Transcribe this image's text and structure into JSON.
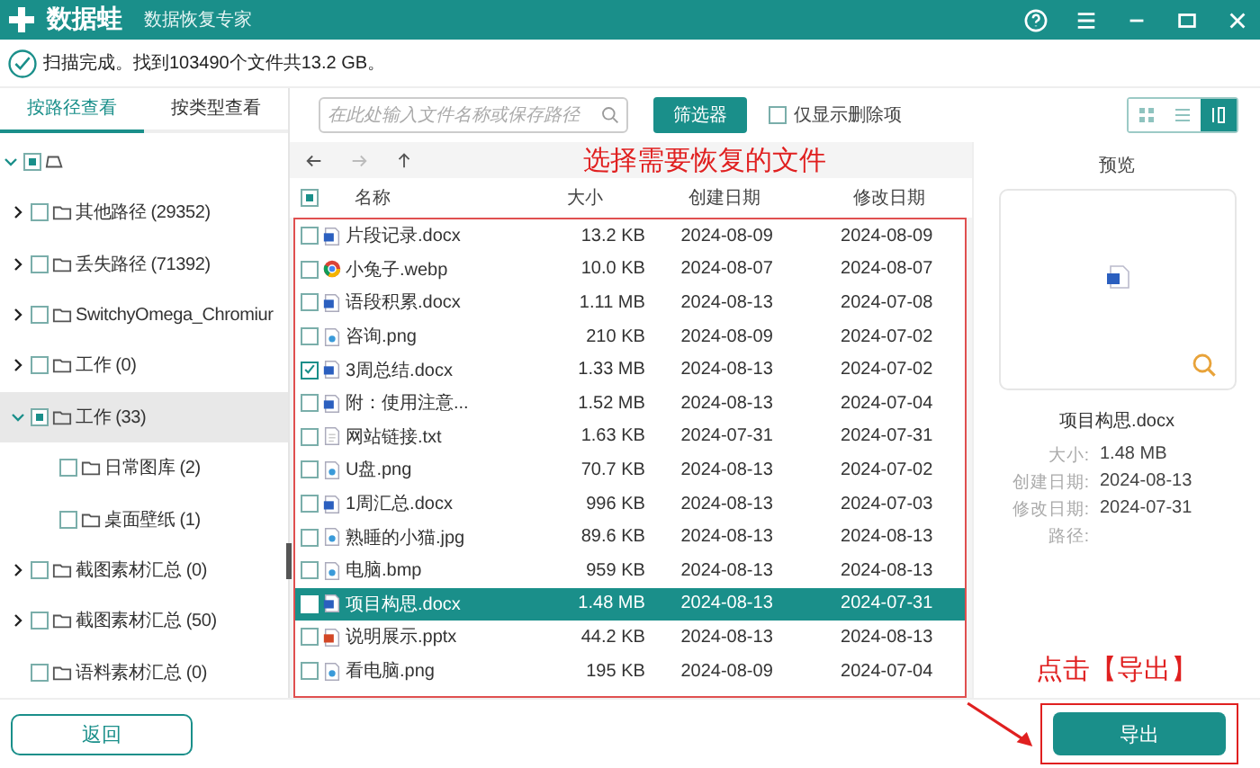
{
  "app": {
    "name": "数据蛙",
    "subtitle": "数据恢复专家"
  },
  "status": "扫描完成。找到103490个文件共13.2 GB。",
  "view_tabs": [
    {
      "label": "按路径查看",
      "selected": true
    },
    {
      "label": "按类型查看",
      "selected": false
    }
  ],
  "tree": [
    {
      "expanded": true,
      "partial": true,
      "selected": false,
      "children": [
        {
          "label": "其他路径 (29352)",
          "expanded": false,
          "has_children": true,
          "partial": false,
          "selected": false
        },
        {
          "label": "丢失路径 (71392)",
          "expanded": false,
          "has_children": true,
          "partial": false,
          "selected": false
        },
        {
          "label": "SwitchyOmega_Chromiur",
          "expanded": false,
          "has_children": true,
          "partial": false,
          "selected": false
        },
        {
          "label": "工作 (0)",
          "expanded": false,
          "has_children": true,
          "partial": false,
          "selected": false
        },
        {
          "label": "工作 (33)",
          "expanded": true,
          "has_children": true,
          "partial": true,
          "selected": true,
          "children": [
            {
              "label": "日常图库 (2)",
              "has_children": false,
              "partial": false,
              "selected": false
            },
            {
              "label": "桌面壁纸 (1)",
              "has_children": false,
              "partial": false,
              "selected": false
            }
          ]
        },
        {
          "label": "截图素材汇总 (0)",
          "expanded": false,
          "has_children": true,
          "partial": false,
          "selected": false
        },
        {
          "label": "截图素材汇总 (50)",
          "expanded": false,
          "has_children": true,
          "partial": false,
          "selected": false
        },
        {
          "label": "语料素材汇总 (0)",
          "has_children": false,
          "partial": false,
          "selected": false
        }
      ]
    }
  ],
  "back_button": "返回",
  "search": {
    "placeholder": "在此处输入文件名称或保存路径"
  },
  "filter_button": "筛选器",
  "deleted_only": {
    "label": "仅显示删除项",
    "checked": false
  },
  "view_modes": [
    {
      "kind": "grid",
      "selected": false
    },
    {
      "kind": "list",
      "selected": false
    },
    {
      "kind": "detail",
      "selected": true
    }
  ],
  "annotations": [
    "选择需要恢复的文件",
    "点击【导出】"
  ],
  "table": {
    "header_partial": true,
    "columns": [
      "名称",
      "大小",
      "创建日期",
      "修改日期"
    ],
    "rows": [
      {
        "kind": "doc",
        "name": "片段记录.docx",
        "size": "13.2 KB",
        "created": "2024-08-09",
        "modified": "2024-08-09",
        "checked": false,
        "selected": false
      },
      {
        "kind": "web",
        "name": "小兔子.webp",
        "size": "10.0 KB",
        "created": "2024-08-07",
        "modified": "2024-08-07",
        "checked": false,
        "selected": false
      },
      {
        "kind": "doc",
        "name": "语段积累.docx",
        "size": "1.11 MB",
        "created": "2024-08-13",
        "modified": "2024-07-08",
        "checked": false,
        "selected": false
      },
      {
        "kind": "image",
        "name": "咨询.png",
        "size": "210 KB",
        "created": "2024-08-09",
        "modified": "2024-07-02",
        "checked": false,
        "selected": false
      },
      {
        "kind": "doc",
        "name": "3周总结.docx",
        "size": "1.33 MB",
        "created": "2024-08-13",
        "modified": "2024-07-02",
        "checked": true,
        "selected": false
      },
      {
        "kind": "doc",
        "name": "附：使用注意...",
        "size": "1.52 MB",
        "created": "2024-08-13",
        "modified": "2024-07-04",
        "checked": false,
        "selected": false
      },
      {
        "kind": "text",
        "name": "网站链接.txt",
        "size": "1.63 KB",
        "created": "2024-07-31",
        "modified": "2024-07-31",
        "checked": false,
        "selected": false
      },
      {
        "kind": "image",
        "name": "U盘.png",
        "size": "70.7 KB",
        "created": "2024-08-13",
        "modified": "2024-07-02",
        "checked": false,
        "selected": false
      },
      {
        "kind": "doc",
        "name": "1周汇总.docx",
        "size": "996 KB",
        "created": "2024-08-13",
        "modified": "2024-07-03",
        "checked": false,
        "selected": false
      },
      {
        "kind": "image",
        "name": "熟睡的小猫.jpg",
        "size": "89.6 KB",
        "created": "2024-08-13",
        "modified": "2024-08-13",
        "checked": false,
        "selected": false
      },
      {
        "kind": "image",
        "name": "电脑.bmp",
        "size": "959 KB",
        "created": "2024-08-13",
        "modified": "2024-08-13",
        "checked": false,
        "selected": false
      },
      {
        "kind": "doc",
        "name": "项目构思.docx",
        "size": "1.48 MB",
        "created": "2024-08-13",
        "modified": "2024-07-31",
        "checked": false,
        "selected": true
      },
      {
        "kind": "slides",
        "name": "说明展示.pptx",
        "size": "44.2 KB",
        "created": "2024-08-13",
        "modified": "2024-08-13",
        "checked": false,
        "selected": false
      },
      {
        "kind": "image",
        "name": "看电脑.png",
        "size": "195 KB",
        "created": "2024-08-09",
        "modified": "2024-07-04",
        "checked": false,
        "selected": false
      }
    ]
  },
  "preview": {
    "title": "预览",
    "file_name": "项目构思.docx",
    "details": [
      {
        "label": "大小:",
        "value": "1.48 MB"
      },
      {
        "label": "创建日期:",
        "value": "2024-08-13"
      },
      {
        "label": "修改日期:",
        "value": "2024-07-31"
      },
      {
        "label": "路径:"
      }
    ]
  },
  "export_button": "导出"
}
